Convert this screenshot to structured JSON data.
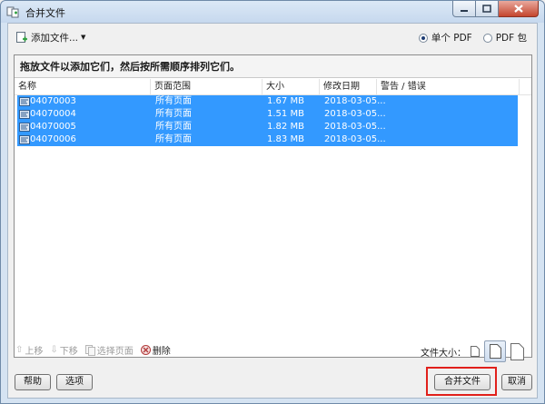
{
  "window": {
    "title": "合并文件"
  },
  "toolbar": {
    "add_label": "添加文件..."
  },
  "output_mode": {
    "options": [
      {
        "label": "单个 PDF",
        "selected": true
      },
      {
        "label": "PDF 包",
        "selected": false
      }
    ]
  },
  "instruction": "拖放文件以添加它们，然后按所需顺序排列它们。",
  "columns": [
    "名称",
    "页面范围",
    "大小",
    "修改日期",
    "警告 / 错误"
  ],
  "files": [
    {
      "name": "04070003",
      "range": "所有页面",
      "size": "1.67 MB",
      "date": "2018-03-05..."
    },
    {
      "name": "04070004",
      "range": "所有页面",
      "size": "1.51 MB",
      "date": "2018-03-05..."
    },
    {
      "name": "04070005",
      "range": "所有页面",
      "size": "1.82 MB",
      "date": "2018-03-05..."
    },
    {
      "name": "04070006",
      "range": "所有页面",
      "size": "1.83 MB",
      "date": "2018-03-05..."
    }
  ],
  "pane_tools": {
    "move_up": "上移",
    "move_down": "下移",
    "choose_pages": "选择页面",
    "delete": "删除"
  },
  "file_size_label": "文件大小：",
  "footer": {
    "help": "帮助",
    "options": "选项",
    "merge": "合并文件",
    "cancel": "取消"
  },
  "colors": {
    "selection": "#3399ff",
    "highlight": "#e1201b"
  }
}
